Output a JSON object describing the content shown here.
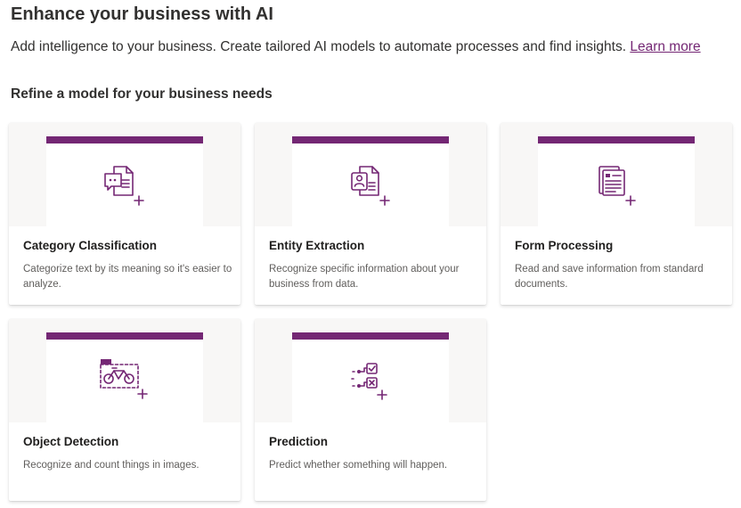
{
  "header": {
    "title": "Enhance your business with AI",
    "subtitle": "Add intelligence to your business. Create tailored AI models to automate processes and find insights.",
    "learn_more": "Learn more"
  },
  "section": {
    "heading": "Refine a model for your business needs"
  },
  "colors": {
    "accent": "#742774",
    "hero_background": "#f8f7f6"
  },
  "cards": [
    {
      "title": "Category Classification",
      "description": "Categorize text by its meaning so it's easier to analyze.",
      "icon": "chat-document-icon"
    },
    {
      "title": "Entity Extraction",
      "description": "Recognize specific information about your business from data.",
      "icon": "contact-document-icon"
    },
    {
      "title": "Form Processing",
      "description": "Read and save information from standard documents.",
      "icon": "form-document-icon"
    },
    {
      "title": "Object Detection",
      "description": "Recognize and count things in images.",
      "icon": "bicycle-detection-icon"
    },
    {
      "title": "Prediction",
      "description": "Predict whether something will happen.",
      "icon": "prediction-checkbox-icon"
    }
  ]
}
